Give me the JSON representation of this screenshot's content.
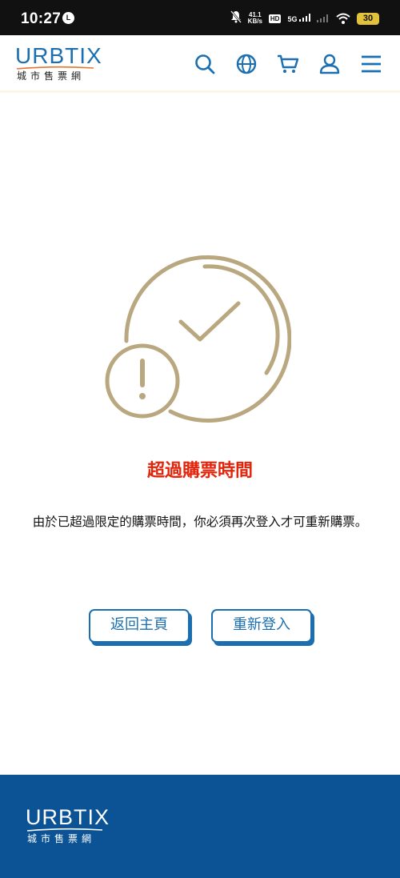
{
  "status_bar": {
    "time": "10:27",
    "l_icon": "L",
    "net_speed_value": "41.1",
    "net_speed_unit": "KB/s",
    "hd_label": "HD",
    "network_label": "5G",
    "battery": "30",
    "icons": [
      "mute-bell-icon",
      "signal-icon",
      "wifi-icon",
      "battery-icon"
    ]
  },
  "header": {
    "logo_text": "URBTIX",
    "logo_subtext": "城市售票網",
    "nav_icons": [
      "search-icon",
      "globe-icon",
      "cart-icon",
      "user-icon",
      "menu-icon"
    ]
  },
  "main": {
    "illustration_icon": "clock-timeout-warning-icon",
    "title": "超過購票時間",
    "message": "由於已超過限定的購票時間，你必須再次登入才可重新購票。",
    "buttons": {
      "home_label": "返回主頁",
      "login_label": "重新登入"
    }
  },
  "footer": {
    "logo_text": "URBTIX",
    "logo_subtext": "城市售票網"
  },
  "colors": {
    "brand_blue": "#1b6fb0",
    "footer_blue": "#0b5394",
    "title_red": "#e3230a",
    "illustration_gold": "#b9a77f"
  }
}
